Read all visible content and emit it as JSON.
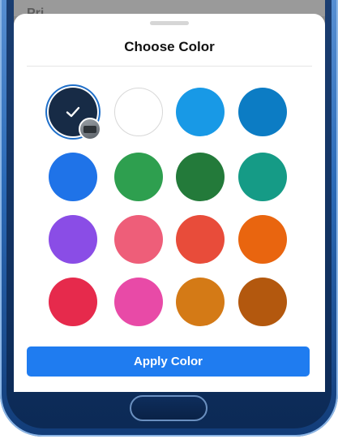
{
  "sheet": {
    "title": "Choose Color",
    "apply_label": "Apply Color"
  },
  "background_text": "Pri",
  "swatches": [
    {
      "name": "color-navy",
      "color": "#172b46",
      "selected": true
    },
    {
      "name": "color-white",
      "color": "#ffffff",
      "selected": false
    },
    {
      "name": "color-sky-blue",
      "color": "#1899e6",
      "selected": false
    },
    {
      "name": "color-ocean-blue",
      "color": "#0c7cc4",
      "selected": false
    },
    {
      "name": "color-blue",
      "color": "#1f73e8",
      "selected": false
    },
    {
      "name": "color-green",
      "color": "#2e9f4f",
      "selected": false
    },
    {
      "name": "color-dark-green",
      "color": "#237a3a",
      "selected": false
    },
    {
      "name": "color-teal",
      "color": "#159b86",
      "selected": false
    },
    {
      "name": "color-purple",
      "color": "#8a4de6",
      "selected": false
    },
    {
      "name": "color-rose",
      "color": "#ee5e79",
      "selected": false
    },
    {
      "name": "color-red-orange",
      "color": "#e84c3a",
      "selected": false
    },
    {
      "name": "color-orange",
      "color": "#e9650f",
      "selected": false
    },
    {
      "name": "color-crimson",
      "color": "#e62a4c",
      "selected": false
    },
    {
      "name": "color-pink",
      "color": "#e84aa7",
      "selected": false
    },
    {
      "name": "color-amber",
      "color": "#d47a16",
      "selected": false
    },
    {
      "name": "color-brown",
      "color": "#b3580e",
      "selected": false
    }
  ]
}
